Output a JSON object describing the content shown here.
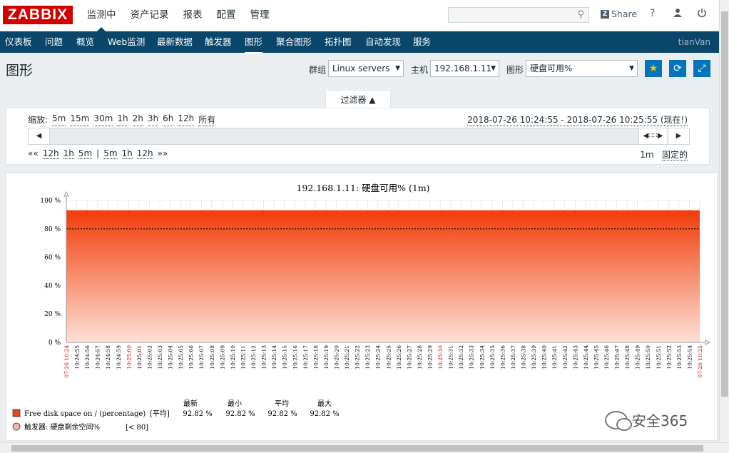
{
  "header": {
    "logo": "ZABBIX",
    "menu": [
      "监测中",
      "资产记录",
      "报表",
      "配置",
      "管理"
    ],
    "share": "Share",
    "help": "?",
    "user_icon": "user-icon",
    "logout_icon": "power-icon"
  },
  "nav": {
    "items": [
      "仪表板",
      "问题",
      "概览",
      "Web监测",
      "最新数据",
      "触发器",
      "图形",
      "聚合图形",
      "拓扑图",
      "自动发现",
      "服务"
    ],
    "active": "图形",
    "user": "tianVan"
  },
  "page": {
    "title": "图形",
    "group_label": "群组",
    "group_value": "Linux servers",
    "host_label": "主机",
    "host_value": "192.168.1.11",
    "graph_label": "图形",
    "graph_value": "硬盘可用%"
  },
  "filter": {
    "tab_label": "过滤器 ▲",
    "zoom_label": "缩放:",
    "zoom_options": [
      "5m",
      "15m",
      "30m",
      "1h",
      "2h",
      "3h",
      "6h",
      "12h",
      "所有"
    ],
    "date_range": "2018-07-26 10:24:55 - 2018-07-26 10:25:55 (现在!)",
    "nav_left": [
      "««",
      "12h",
      "1h",
      "5m",
      "|",
      "5m",
      "1h",
      "12h",
      "»»"
    ],
    "period": "1m",
    "fixed": "固定的"
  },
  "chart_data": {
    "type": "area",
    "title": "192.168.1.11: 硬盘可用% (1m)",
    "ylim": [
      0,
      100
    ],
    "yticks": [
      "100 %",
      "80 %",
      "60 %",
      "40 %",
      "20 %",
      "0 %"
    ],
    "threshold": 80,
    "value": 92.82,
    "x_labels": [
      "07-26 10:24",
      "10:24:55",
      "10:24:56",
      "10:24:57",
      "10:24:58",
      "10:24:59",
      "10:25:00",
      "10:25:01",
      "10:25:02",
      "10:25:03",
      "10:25:04",
      "10:25:05",
      "10:25:06",
      "10:25:07",
      "10:25:08",
      "10:25:09",
      "10:25:10",
      "10:25:11",
      "10:25:12",
      "10:25:13",
      "10:25:14",
      "10:25:15",
      "10:25:16",
      "10:25:17",
      "10:25:18",
      "10:25:19",
      "10:25:20",
      "10:25:21",
      "10:25:22",
      "10:25:23",
      "10:25:24",
      "10:25:25",
      "10:25:26",
      "10:25:27",
      "10:25:28",
      "10:25:29",
      "10:25:30",
      "10:25:31",
      "10:25:32",
      "10:25:33",
      "10:25:34",
      "10:25:35",
      "10:25:36",
      "10:25:37",
      "10:25:38",
      "10:25:39",
      "10:25:40",
      "10:25:41",
      "10:25:42",
      "10:25:43",
      "10:25:44",
      "10:25:45",
      "10:25:46",
      "10:25:47",
      "10:25:48",
      "10:25:49",
      "10:25:50",
      "10:25:51",
      "10:25:52",
      "10:25:53",
      "10:25:54",
      "07-26 10:25"
    ],
    "red_labels": [
      0,
      6,
      36,
      61
    ],
    "legend": {
      "headers": [
        "最新",
        "最小",
        "平均",
        "最大"
      ],
      "series_name": "Free disk space on / (percentage)",
      "series_agg": "[平均]",
      "series_values": [
        "92.82 %",
        "92.82 %",
        "92.82 %",
        "92.82 %"
      ],
      "trigger_name": "触发器: 硬盘剩余空间%",
      "trigger_cond": "[< 80]"
    },
    "colors": {
      "fill_top": "#f23c0a",
      "fill_bottom": "#fde0d6",
      "series": "#e24a1b"
    }
  },
  "watermark": "安全365"
}
